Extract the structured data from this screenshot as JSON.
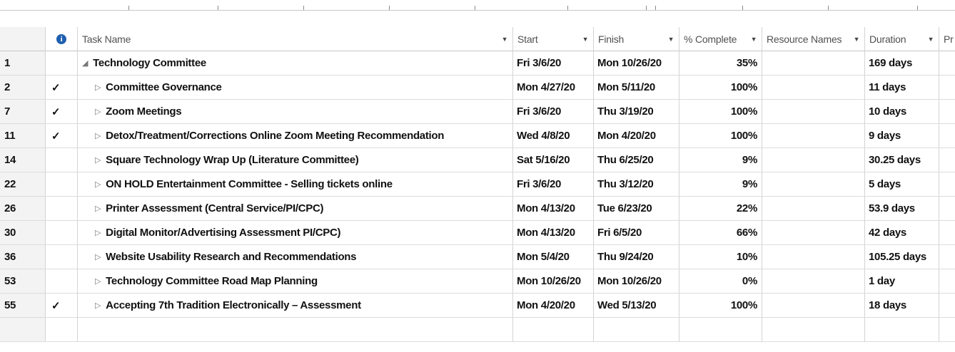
{
  "columns": {
    "task_name": "Task Name",
    "start": "Start",
    "finish": "Finish",
    "pct_complete": "% Complete",
    "resource_names": "Resource Names",
    "duration": "Duration",
    "predecessors_cut": "Pr"
  },
  "icons": {
    "info": "info-icon",
    "dropdown": "chevron-down-icon",
    "done": "checkmark-icon"
  },
  "colors": {
    "check": "#2f6bd0",
    "info": "#1f5fae"
  },
  "rows": [
    {
      "id": "1",
      "check": "",
      "name": "Technology Committee",
      "summary": true,
      "start": "Fri 3/6/20",
      "finish": "Mon 10/26/20",
      "pct": "35%",
      "resources": "",
      "duration": "169 days"
    },
    {
      "id": "2",
      "check": "✓",
      "name": "Committee Governance",
      "start": "Mon 4/27/20",
      "finish": "Mon 5/11/20",
      "pct": "100%",
      "resources": "",
      "duration": "11 days"
    },
    {
      "id": "7",
      "check": "✓",
      "name": "Zoom Meetings",
      "start": "Fri 3/6/20",
      "finish": "Thu 3/19/20",
      "pct": "100%",
      "resources": "",
      "duration": "10 days"
    },
    {
      "id": "11",
      "check": "✓",
      "name": "Detox/Treatment/Corrections Online Zoom Meeting Recommendation",
      "start": "Wed 4/8/20",
      "finish": "Mon 4/20/20",
      "pct": "100%",
      "resources": "",
      "duration": "9 days"
    },
    {
      "id": "14",
      "check": "",
      "name": "Square Technology Wrap Up (Literature Committee)",
      "start": "Sat 5/16/20",
      "finish": "Thu 6/25/20",
      "pct": "9%",
      "resources": "",
      "duration": "30.25 days"
    },
    {
      "id": "22",
      "check": "",
      "name": "ON HOLD Entertainment Committee - Selling tickets online",
      "start": "Fri 3/6/20",
      "finish": "Thu 3/12/20",
      "pct": "9%",
      "resources": "",
      "duration": "5 days"
    },
    {
      "id": "26",
      "check": "",
      "name": "Printer Assessment (Central Service/PI/CPC)",
      "start": "Mon 4/13/20",
      "finish": "Tue 6/23/20",
      "pct": "22%",
      "resources": "",
      "duration": "53.9 days"
    },
    {
      "id": "30",
      "check": "",
      "name": "Digital Monitor/Advertising Assessment PI/CPC)",
      "start": "Mon 4/13/20",
      "finish": "Fri 6/5/20",
      "pct": "66%",
      "resources": "",
      "duration": "42 days"
    },
    {
      "id": "36",
      "check": "",
      "name": "Website Usability Research and Recommendations",
      "start": "Mon 5/4/20",
      "finish": "Thu 9/24/20",
      "pct": "10%",
      "resources": "",
      "duration": "105.25 days"
    },
    {
      "id": "53",
      "check": "",
      "name": "Technology Committee Road Map Planning",
      "start": "Mon 10/26/20",
      "finish": "Mon 10/26/20",
      "pct": "0%",
      "resources": "",
      "duration": "1 day"
    },
    {
      "id": "55",
      "check": "✓",
      "name": "Accepting 7th Tradition Electronically – Assessment",
      "start": "Mon 4/20/20",
      "finish": "Wed 5/13/20",
      "pct": "100%",
      "resources": "",
      "duration": "18 days"
    }
  ]
}
